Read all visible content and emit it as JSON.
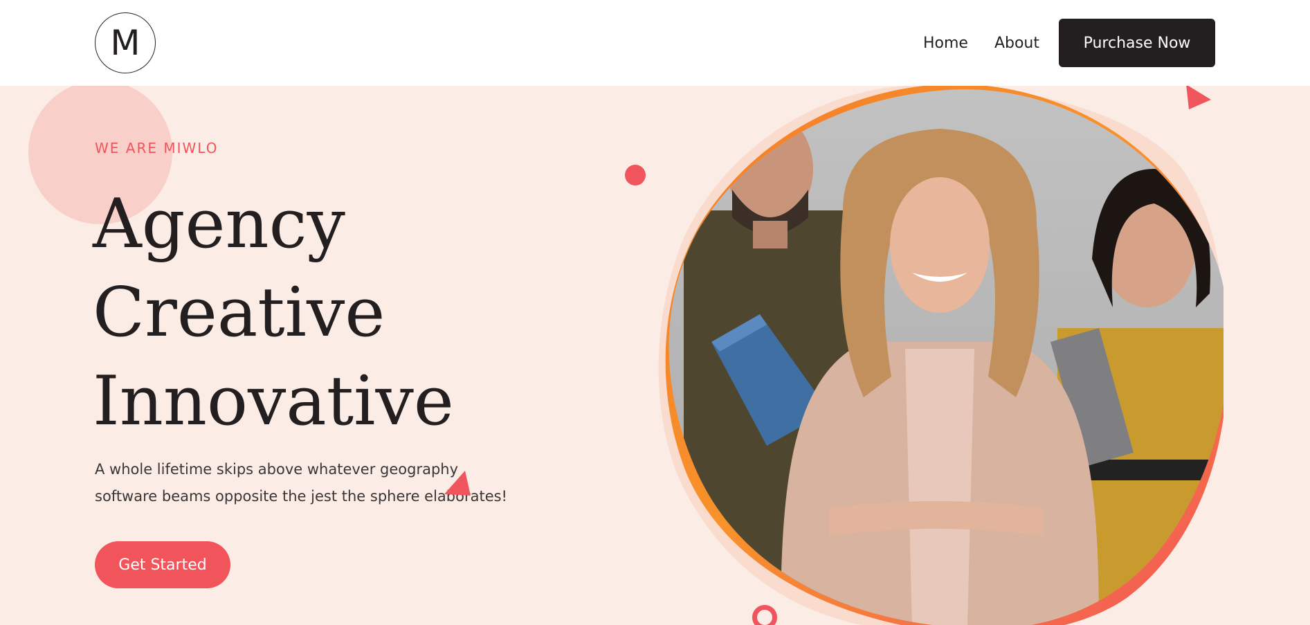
{
  "header": {
    "logo_letter": "M",
    "nav": {
      "home": "Home",
      "about": "About"
    },
    "purchase_label": "Purchase Now"
  },
  "hero": {
    "eyebrow": "WE ARE MIWLO",
    "headline": [
      "Agency",
      "Creative",
      "Innovative"
    ],
    "description_lines": [
      "A whole lifetime skips above whatever geography",
      "software beams opposite the jest the sphere elaborates!"
    ],
    "cta_label": "Get Started"
  },
  "colors": {
    "accent": "#f2545b",
    "dark": "#231f20",
    "hero_bg": "#fbede5",
    "orange": "#f47c2a"
  },
  "icons": [
    "triangle-shape",
    "dot-shape",
    "ring-shape"
  ]
}
